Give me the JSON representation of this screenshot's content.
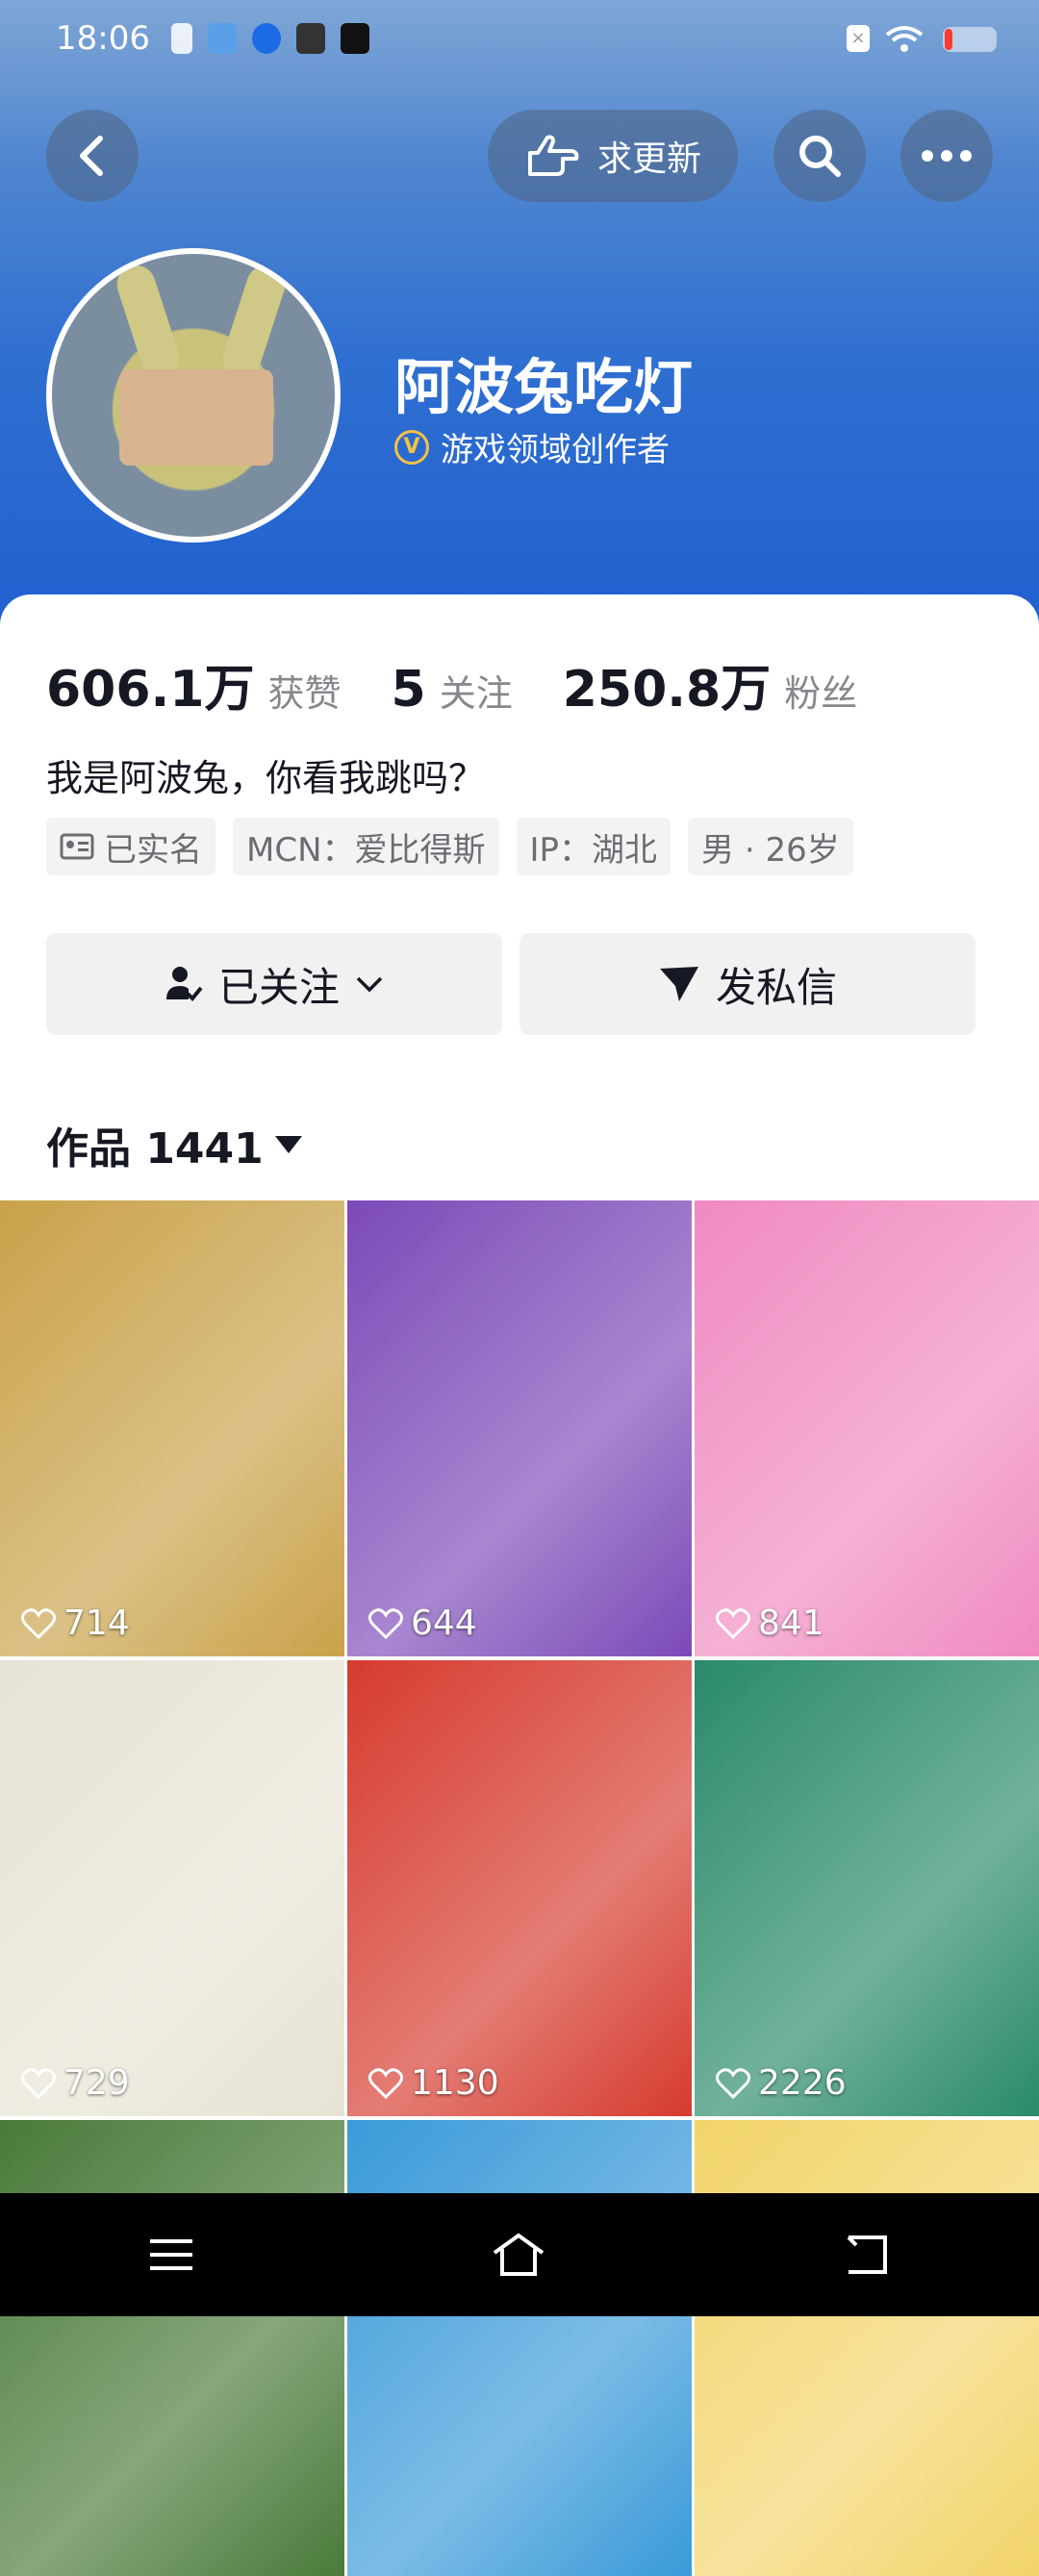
{
  "status_bar": {
    "time": "18:06"
  },
  "header": {
    "request_update_label": "求更新"
  },
  "profile": {
    "name": "阿波兔吃灯",
    "certification": "游戏领域创作者",
    "stats": [
      {
        "value": "606.1万",
        "label": "获赞"
      },
      {
        "value": "5",
        "label": "关注"
      },
      {
        "value": "250.8万",
        "label": "粉丝"
      }
    ],
    "bio": "我是阿波兔，你看我跳吗？",
    "tags": [
      "已实名",
      "MCN：爱比得斯",
      "IP：湖北",
      "男 · 26岁"
    ]
  },
  "actions": {
    "follow_label": "已关注",
    "message_label": "发私信"
  },
  "works": {
    "label": "作品 1441",
    "items": [
      {
        "likes": "714",
        "color": "#c9a24a"
      },
      {
        "likes": "644",
        "color": "#7c4ab8"
      },
      {
        "likes": "841",
        "color": "#f08ac0"
      },
      {
        "likes": "729",
        "color": "#e7e3d4"
      },
      {
        "likes": "1130",
        "color": "#d63b2f"
      },
      {
        "likes": "2226",
        "color": "#2a8a6a"
      },
      {
        "likes": "",
        "color": "#4a7a3a"
      },
      {
        "likes": "",
        "color": "#3a9ad9"
      },
      {
        "likes": "",
        "color": "#f2d46a"
      }
    ]
  }
}
